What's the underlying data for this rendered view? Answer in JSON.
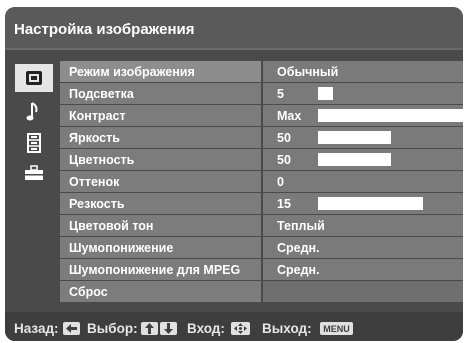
{
  "title": "Настройка изображения",
  "sidebar": {
    "icons": [
      {
        "name": "picture-icon",
        "active": true
      },
      {
        "name": "music-note-icon",
        "active": false
      },
      {
        "name": "film-icon",
        "active": false
      },
      {
        "name": "toolbox-icon",
        "active": false
      }
    ]
  },
  "menu": {
    "items": [
      {
        "label": "Режим изображения",
        "value": "Обычный"
      },
      {
        "label": "Подсветка",
        "value": "5",
        "level": 0.1
      },
      {
        "label": "Контраст",
        "value": "Max",
        "level": 1.0
      },
      {
        "label": "Яркость",
        "value": "50",
        "level": 0.5
      },
      {
        "label": "Цветность",
        "value": "50",
        "level": 0.5
      },
      {
        "label": "Оттенок",
        "value": "0"
      },
      {
        "label": "Резкость",
        "value": "15",
        "level": 0.72
      },
      {
        "label": "Цветовой тон",
        "value": "Теплый"
      },
      {
        "label": "Шумопонижение",
        "value": "Средн."
      },
      {
        "label": "Шумопонижение для MPEG",
        "value": "Средн."
      },
      {
        "label": "Сброс",
        "value": ""
      }
    ]
  },
  "footer": {
    "back_label": "Назад:",
    "select_label": "Выбор:",
    "enter_label": "Вход:",
    "exit_label": "Выход:",
    "menu_key": "MENU"
  },
  "colors": {
    "background": "#4a4a4a",
    "row": "#7a7a7a",
    "text": "#ffffff"
  }
}
